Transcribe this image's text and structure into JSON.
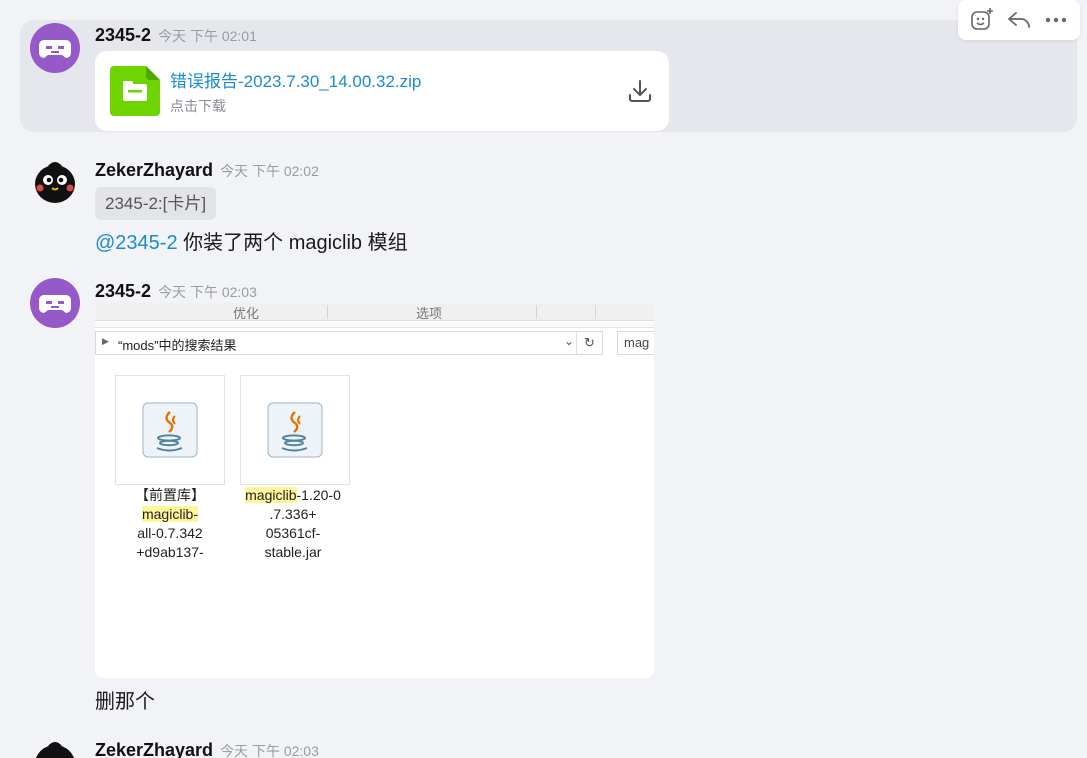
{
  "messages": [
    {
      "sender": "2345-2",
      "time": "今天 下午 02:01",
      "file": {
        "name": "错误报告-2023.7.30_14.00.32.zip",
        "action": "点击下载"
      }
    },
    {
      "sender": "ZekerZhayard",
      "time": "今天 下午 02:02",
      "quote": "2345-2:[卡片]",
      "mention": "@2345-2",
      "text": " 你装了两个 magiclib 模组"
    },
    {
      "sender": "2345-2",
      "time": "今天 下午 02:03",
      "screenshot": {
        "ribbon_left": "优化",
        "ribbon_right": "选项",
        "address": "“mods”中的搜索结果",
        "search": "mag",
        "files": [
          {
            "line1": "【前置库】",
            "highlight": "magiclib-",
            "rest": [
              "all-0.7.342",
              "+d9ab137-"
            ]
          },
          {
            "highlight": "magiclib",
            "line1_rest": "-1.20-0",
            "rest": [
              ".7.336+",
              "05361cf-",
              "stable.jar"
            ]
          }
        ]
      },
      "text": "删那个"
    },
    {
      "sender": "ZekerZhayard",
      "time": "今天 下午 02:03"
    }
  ],
  "actions": [
    "emoji-add-icon",
    "reply-icon",
    "more-icon"
  ],
  "colors": {
    "link": "#1a8ad4",
    "avatar_purple": "#9659c8",
    "file_green": "#6dd400",
    "highlight": "#fff59a"
  }
}
